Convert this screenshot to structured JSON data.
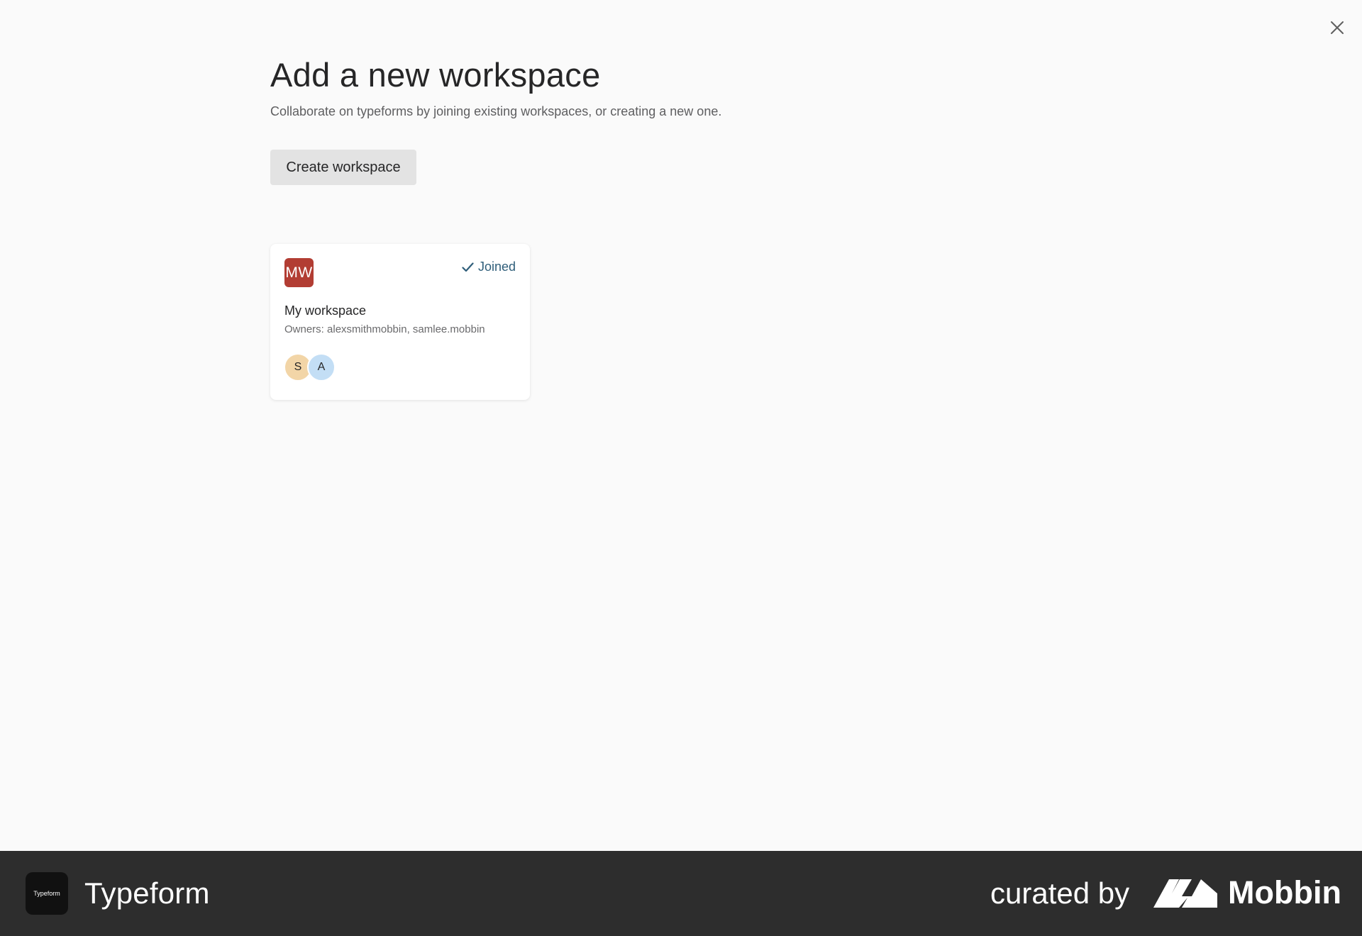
{
  "header": {
    "title": "Add a new workspace",
    "subtitle": "Collaborate on typeforms by joining existing workspaces, or creating a new one.",
    "close_icon": "close-icon"
  },
  "actions": {
    "create_label": "Create workspace"
  },
  "workspaces": [
    {
      "initials": "MW",
      "name": "My workspace",
      "owners": "Owners: alexsmithmobbin, samlee.mobbin",
      "status": "Joined",
      "status_icon": "checkmark-icon",
      "avatar_color": "#b23d33",
      "members": [
        {
          "initial": "S",
          "color": "#f2d5a7"
        },
        {
          "initial": "A",
          "color": "#c3def5"
        }
      ]
    }
  ],
  "footer": {
    "app_logo_text": "Typeform",
    "app_name": "Typeform",
    "curated_label": "curated by",
    "brand_name": "Mobbin",
    "background": "#2d2d2d"
  },
  "colors": {
    "page_background": "#fafafa",
    "joined_accent": "#2f5e7a",
    "button_background": "#e3e3e3"
  }
}
